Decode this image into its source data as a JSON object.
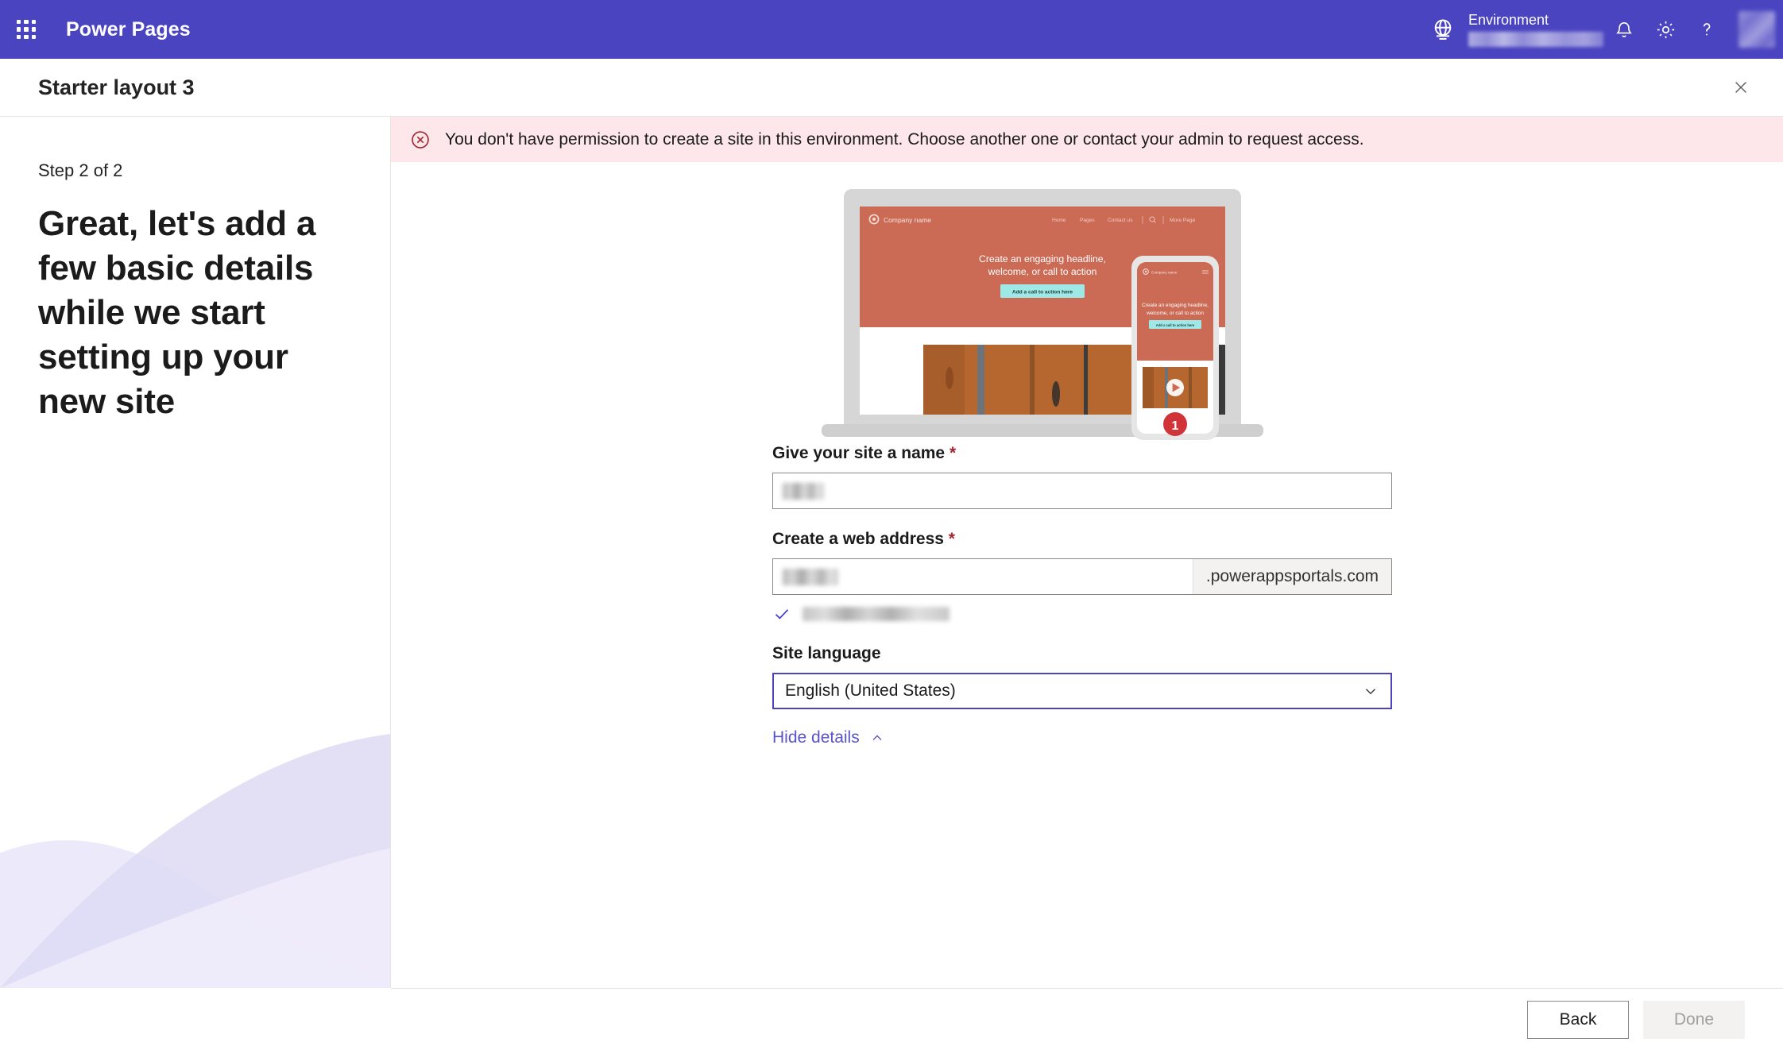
{
  "appbar": {
    "waffle_icon": "waffle-grid-icon",
    "title": "Power Pages",
    "globe_icon": "globe-environment-icon",
    "environment_label": "Environment",
    "environment_value": "",
    "notifications_icon": "bell-icon",
    "settings_icon": "gear-icon",
    "help_icon": "question-mark-icon",
    "avatar": "user-avatar",
    "bg_color": "#4a44c0"
  },
  "subheader": {
    "title": "Starter layout 3",
    "close_icon": "close-icon"
  },
  "left_panel": {
    "step": "Step 2 of 2",
    "headline": "Great, let's add a few basic details while we start setting up your new site"
  },
  "error": {
    "icon": "error-circle-x-icon",
    "message": "You don't have permission to create a site in this environment. Choose another one or contact your admin to request access.",
    "bg_color": "#fde7eb",
    "icon_color": "#a4262c"
  },
  "preview": {
    "device_laptop": "laptop-mockup",
    "device_phone": "phone-mockup",
    "company_name": "Company name",
    "nav_items": [
      "Home",
      "Pages",
      "Contact us",
      "More Page"
    ],
    "search_icon": "search-icon",
    "hero_headline_line1": "Create an engaging headline,",
    "hero_headline_line2": "welcome, or call to action",
    "cta_label": "Add a call to action here",
    "play_icon": "play-button-icon",
    "badge_number": "1",
    "accent_color": "#cb6a55",
    "cta_color": "#9ee8e8"
  },
  "form": {
    "site_name": {
      "label": "Give your site a name",
      "required_marker": "*",
      "value": ""
    },
    "web_address": {
      "label": "Create a web address",
      "required_marker": "*",
      "value": "",
      "suffix": ".powerappsportals.com",
      "validation_icon": "checkmark-icon",
      "validation_text": ""
    },
    "site_language": {
      "label": "Site language",
      "value": "English (United States)",
      "chevron_icon": "chevron-down-icon",
      "options": [
        "English (United States)"
      ]
    },
    "details_toggle": {
      "label": "Hide details",
      "icon": "chevron-up-icon",
      "link_color": "#5a54c8"
    }
  },
  "footer": {
    "back_label": "Back",
    "done_label": "Done"
  }
}
